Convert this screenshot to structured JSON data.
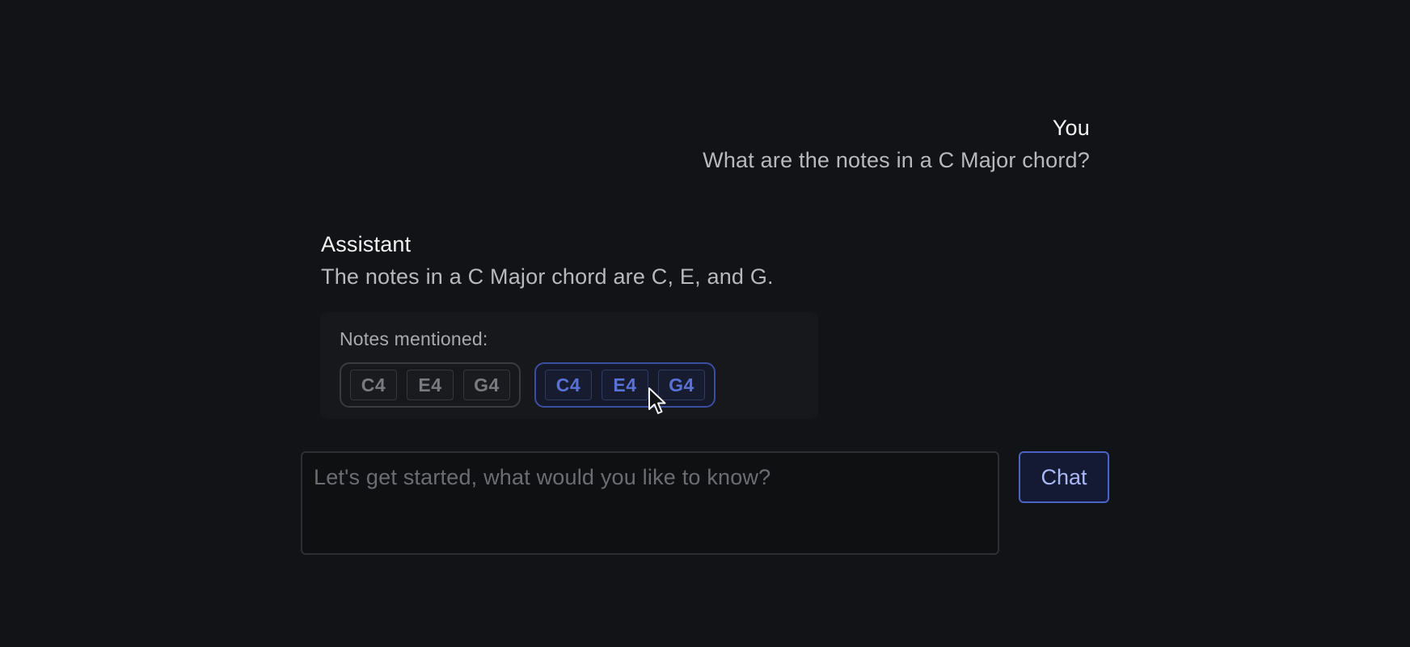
{
  "conversation": {
    "user": {
      "sender": "You",
      "text": "What are the notes in a C Major chord?"
    },
    "assistant": {
      "sender": "Assistant",
      "text": "The notes in a C Major chord are C, E, and G.",
      "notes_panel": {
        "label": "Notes mentioned:",
        "groups": [
          {
            "state": "default",
            "notes": [
              "C4",
              "E4",
              "G4"
            ]
          },
          {
            "state": "hovered",
            "notes": [
              "C4",
              "E4",
              "G4"
            ]
          }
        ]
      }
    }
  },
  "composer": {
    "placeholder": "Let's get started, what would you like to know?",
    "value": "",
    "send_label": "Chat"
  },
  "colors": {
    "background": "#121316",
    "accent": "#4a63c4",
    "accent_text": "#5a72d6"
  },
  "icons": {
    "pointer": "mouse-pointer-icon"
  }
}
